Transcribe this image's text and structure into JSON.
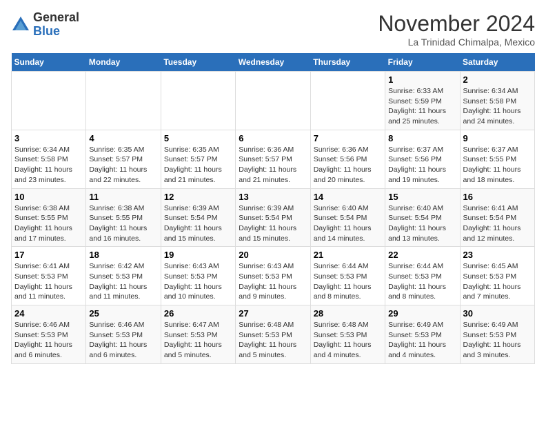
{
  "header": {
    "logo_general": "General",
    "logo_blue": "Blue",
    "month_title": "November 2024",
    "location": "La Trinidad Chimalpa, Mexico"
  },
  "weekdays": [
    "Sunday",
    "Monday",
    "Tuesday",
    "Wednesday",
    "Thursday",
    "Friday",
    "Saturday"
  ],
  "weeks": [
    [
      {
        "day": "",
        "info": ""
      },
      {
        "day": "",
        "info": ""
      },
      {
        "day": "",
        "info": ""
      },
      {
        "day": "",
        "info": ""
      },
      {
        "day": "",
        "info": ""
      },
      {
        "day": "1",
        "info": "Sunrise: 6:33 AM\nSunset: 5:59 PM\nDaylight: 11 hours and 25 minutes."
      },
      {
        "day": "2",
        "info": "Sunrise: 6:34 AM\nSunset: 5:58 PM\nDaylight: 11 hours and 24 minutes."
      }
    ],
    [
      {
        "day": "3",
        "info": "Sunrise: 6:34 AM\nSunset: 5:58 PM\nDaylight: 11 hours and 23 minutes."
      },
      {
        "day": "4",
        "info": "Sunrise: 6:35 AM\nSunset: 5:57 PM\nDaylight: 11 hours and 22 minutes."
      },
      {
        "day": "5",
        "info": "Sunrise: 6:35 AM\nSunset: 5:57 PM\nDaylight: 11 hours and 21 minutes."
      },
      {
        "day": "6",
        "info": "Sunrise: 6:36 AM\nSunset: 5:57 PM\nDaylight: 11 hours and 21 minutes."
      },
      {
        "day": "7",
        "info": "Sunrise: 6:36 AM\nSunset: 5:56 PM\nDaylight: 11 hours and 20 minutes."
      },
      {
        "day": "8",
        "info": "Sunrise: 6:37 AM\nSunset: 5:56 PM\nDaylight: 11 hours and 19 minutes."
      },
      {
        "day": "9",
        "info": "Sunrise: 6:37 AM\nSunset: 5:55 PM\nDaylight: 11 hours and 18 minutes."
      }
    ],
    [
      {
        "day": "10",
        "info": "Sunrise: 6:38 AM\nSunset: 5:55 PM\nDaylight: 11 hours and 17 minutes."
      },
      {
        "day": "11",
        "info": "Sunrise: 6:38 AM\nSunset: 5:55 PM\nDaylight: 11 hours and 16 minutes."
      },
      {
        "day": "12",
        "info": "Sunrise: 6:39 AM\nSunset: 5:54 PM\nDaylight: 11 hours and 15 minutes."
      },
      {
        "day": "13",
        "info": "Sunrise: 6:39 AM\nSunset: 5:54 PM\nDaylight: 11 hours and 15 minutes."
      },
      {
        "day": "14",
        "info": "Sunrise: 6:40 AM\nSunset: 5:54 PM\nDaylight: 11 hours and 14 minutes."
      },
      {
        "day": "15",
        "info": "Sunrise: 6:40 AM\nSunset: 5:54 PM\nDaylight: 11 hours and 13 minutes."
      },
      {
        "day": "16",
        "info": "Sunrise: 6:41 AM\nSunset: 5:54 PM\nDaylight: 11 hours and 12 minutes."
      }
    ],
    [
      {
        "day": "17",
        "info": "Sunrise: 6:41 AM\nSunset: 5:53 PM\nDaylight: 11 hours and 11 minutes."
      },
      {
        "day": "18",
        "info": "Sunrise: 6:42 AM\nSunset: 5:53 PM\nDaylight: 11 hours and 11 minutes."
      },
      {
        "day": "19",
        "info": "Sunrise: 6:43 AM\nSunset: 5:53 PM\nDaylight: 11 hours and 10 minutes."
      },
      {
        "day": "20",
        "info": "Sunrise: 6:43 AM\nSunset: 5:53 PM\nDaylight: 11 hours and 9 minutes."
      },
      {
        "day": "21",
        "info": "Sunrise: 6:44 AM\nSunset: 5:53 PM\nDaylight: 11 hours and 8 minutes."
      },
      {
        "day": "22",
        "info": "Sunrise: 6:44 AM\nSunset: 5:53 PM\nDaylight: 11 hours and 8 minutes."
      },
      {
        "day": "23",
        "info": "Sunrise: 6:45 AM\nSunset: 5:53 PM\nDaylight: 11 hours and 7 minutes."
      }
    ],
    [
      {
        "day": "24",
        "info": "Sunrise: 6:46 AM\nSunset: 5:53 PM\nDaylight: 11 hours and 6 minutes."
      },
      {
        "day": "25",
        "info": "Sunrise: 6:46 AM\nSunset: 5:53 PM\nDaylight: 11 hours and 6 minutes."
      },
      {
        "day": "26",
        "info": "Sunrise: 6:47 AM\nSunset: 5:53 PM\nDaylight: 11 hours and 5 minutes."
      },
      {
        "day": "27",
        "info": "Sunrise: 6:48 AM\nSunset: 5:53 PM\nDaylight: 11 hours and 5 minutes."
      },
      {
        "day": "28",
        "info": "Sunrise: 6:48 AM\nSunset: 5:53 PM\nDaylight: 11 hours and 4 minutes."
      },
      {
        "day": "29",
        "info": "Sunrise: 6:49 AM\nSunset: 5:53 PM\nDaylight: 11 hours and 4 minutes."
      },
      {
        "day": "30",
        "info": "Sunrise: 6:49 AM\nSunset: 5:53 PM\nDaylight: 11 hours and 3 minutes."
      }
    ]
  ]
}
